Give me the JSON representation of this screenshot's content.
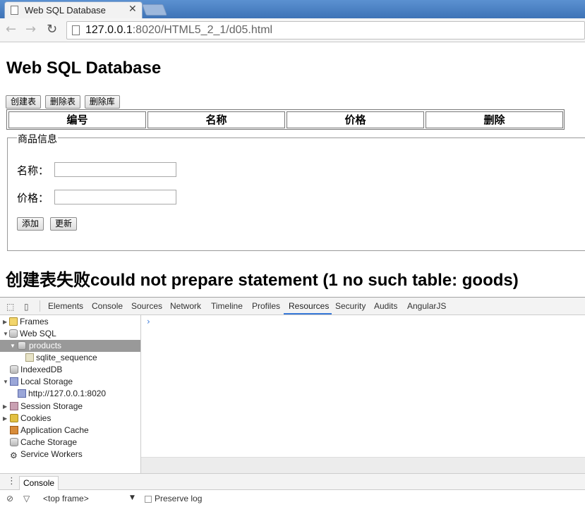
{
  "browser": {
    "tab_title": "Web SQL Database",
    "tab_close": "✕",
    "url_host": "127.0.0.1",
    "url_rest": ":8020/HTML5_2_1/d05.html"
  },
  "page": {
    "heading": "Web SQL Database",
    "buttons": {
      "create_table": "创建表",
      "delete_table": "删除表",
      "delete_db": "删除库"
    },
    "table_headers": [
      "编号",
      "名称",
      "价格",
      "删除"
    ],
    "form": {
      "legend": "商品信息",
      "name_label": "名称：",
      "name_value": "",
      "price_label": "价格：",
      "price_value": "",
      "add_button": "添加",
      "update_button": "更新"
    },
    "status_message": "创建表失败could not prepare statement (1 no such table: goods)"
  },
  "devtools": {
    "tabs": [
      "Elements",
      "Console",
      "Sources",
      "Network",
      "Timeline",
      "Profiles",
      "Resources",
      "Security",
      "Audits",
      "AngularJS"
    ],
    "active_tab": "Resources",
    "tree": {
      "frames": "Frames",
      "web_sql": "Web SQL",
      "products": "products",
      "sqlite_sequence": "sqlite_sequence",
      "indexeddb": "IndexedDB",
      "local_storage": "Local Storage",
      "local_origin": "http://127.0.0.1:8020",
      "session_storage": "Session Storage",
      "cookies": "Cookies",
      "app_cache": "Application Cache",
      "cache_storage": "Cache Storage",
      "service_workers": "Service Workers"
    },
    "prompt": "›",
    "drawer_tab": "Console",
    "frame_select": "<top frame>",
    "preserve_log": "Preserve log"
  }
}
